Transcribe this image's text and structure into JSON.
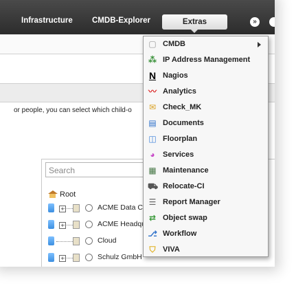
{
  "topnav": {
    "items": [
      "Infrastructure",
      "CMDB-Explorer"
    ],
    "active": "Extras",
    "circle_glyph": "»"
  },
  "info_text": "or people, you can select which child-o",
  "tree": {
    "search_placeholder": "Search",
    "root_label": "Root",
    "rows": [
      "ACME Data Ce",
      "ACME Headqu",
      "Cloud",
      "Schulz GmbH"
    ]
  },
  "menu": {
    "items": [
      {
        "label": "CMDB",
        "icon": "cmdb-icon",
        "submenu": true
      },
      {
        "label": "IP Address Management",
        "icon": "network-icon"
      },
      {
        "label": "Nagios",
        "icon": "nagios-icon"
      },
      {
        "label": "Analytics",
        "icon": "analytics-icon"
      },
      {
        "label": "Check_MK",
        "icon": "checkmk-icon"
      },
      {
        "label": "Documents",
        "icon": "documents-icon"
      },
      {
        "label": "Floorplan",
        "icon": "floorplan-icon"
      },
      {
        "label": "Services",
        "icon": "services-icon"
      },
      {
        "label": "Maintenance",
        "icon": "maintenance-icon"
      },
      {
        "label": "Relocate-CI",
        "icon": "relocate-icon"
      },
      {
        "label": "Report Manager",
        "icon": "report-icon"
      },
      {
        "label": "Object swap",
        "icon": "swap-icon"
      },
      {
        "label": "Workflow",
        "icon": "workflow-icon"
      },
      {
        "label": "VIVA",
        "icon": "viva-icon"
      }
    ]
  }
}
